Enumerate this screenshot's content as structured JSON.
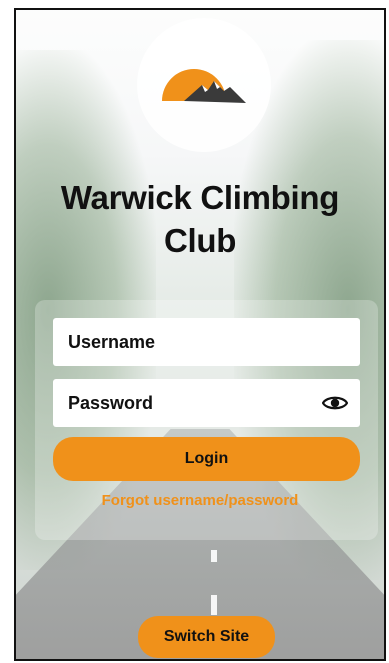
{
  "app": {
    "title_line1": "Warwick Climbing",
    "title_line2": "Club"
  },
  "logo": {
    "icon": "sun-mountain-logo",
    "sun_color": "#f0911a",
    "mountain_color": "#3a3a3a"
  },
  "form": {
    "username_label": "Username",
    "password_label": "Password",
    "password_toggle_icon": "eye-icon",
    "login_label": "Login",
    "forgot_label": "Forgot username/password"
  },
  "footer": {
    "switch_site_label": "Switch Site"
  },
  "colors": {
    "accent": "#f0911a",
    "text": "#111111",
    "field_bg": "#ffffff"
  }
}
